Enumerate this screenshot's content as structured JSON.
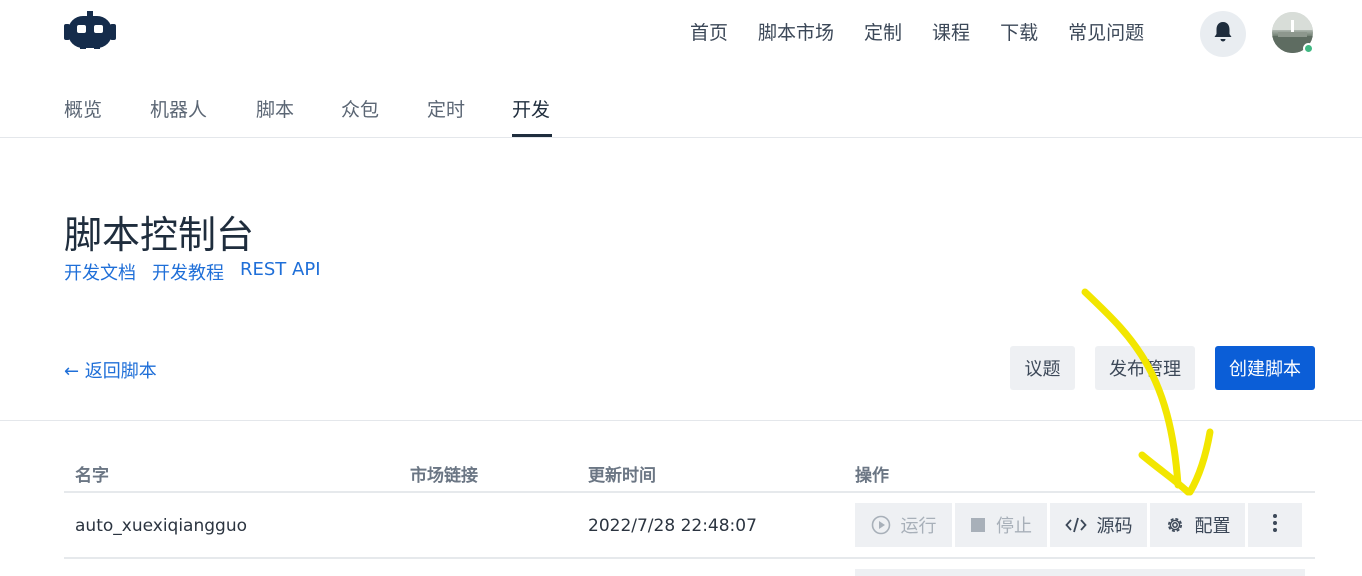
{
  "header": {
    "nav": [
      "首页",
      "脚本市场",
      "定制",
      "课程",
      "下载",
      "常见问题"
    ]
  },
  "tabs": {
    "items": [
      "概览",
      "机器人",
      "脚本",
      "众包",
      "定时",
      "开发"
    ],
    "active": "开发"
  },
  "page": {
    "title": "脚本控制台",
    "links": [
      "开发文档",
      "开发教程",
      "REST API"
    ]
  },
  "actions": {
    "back": "← 返回脚本",
    "issues": "议题",
    "release": "发布管理",
    "create": "创建脚本"
  },
  "table": {
    "columns": [
      "名字",
      "市场链接",
      "更新时间",
      "操作"
    ],
    "rows": [
      {
        "name": "auto_xuexiqiangguo",
        "market_link": "",
        "updated": "2022/7/28 22:48:07",
        "ops": {
          "run": "运行",
          "stop": "停止",
          "source": "源码",
          "config": "配置"
        }
      }
    ]
  },
  "colors": {
    "accent": "#0b5ed7",
    "link": "#1f6fd8",
    "annotation": "#f2e600",
    "online": "#41b883"
  }
}
